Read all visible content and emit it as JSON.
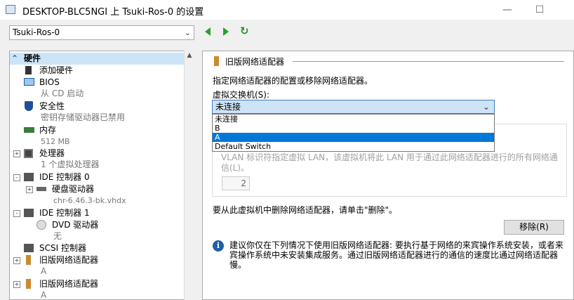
{
  "window": {
    "title": "DESKTOP-BLC5NGI 上 Tsuki-Ros-0 的设置"
  },
  "toolbar": {
    "vm_selected": "Tsuki-Ros-0"
  },
  "tree": {
    "section_hardware": "硬件",
    "add_hardware": "添加硬件",
    "bios": {
      "label": "BIOS",
      "sub": "从 CD 启动"
    },
    "security": {
      "label": "安全性",
      "sub": "密钥存储驱动器已禁用"
    },
    "memory": {
      "label": "内存",
      "sub": "512 MB"
    },
    "processor": {
      "label": "处理器",
      "sub": "1 个虚拟处理器"
    },
    "ide0": {
      "label": "IDE 控制器 0"
    },
    "harddisk": {
      "label": "硬盘驱动器",
      "sub": "chr-6.46.3-bk.vhdx"
    },
    "ide1": {
      "label": "IDE 控制器 1"
    },
    "dvd": {
      "label": "DVD 驱动器",
      "sub": "无"
    },
    "scsi": {
      "label": "SCSI 控制器"
    },
    "legacy_nic_1": {
      "label": "旧版网络适配器",
      "sub": "A"
    },
    "legacy_nic_2": {
      "label": "旧版网络适配器",
      "sub": "A"
    }
  },
  "main": {
    "section_title": "旧版网络适配器",
    "description": "指定网络适配器的配置或移除网络适配器。",
    "switch_label": "虚拟交换机(S):",
    "switch_value": "未连接",
    "switch_options": [
      "未连接",
      "B",
      "A",
      "Default Switch"
    ],
    "switch_highlighted": "A",
    "vlan_text": "VLAN 标识符指定虚拟 LAN，该虚拟机将此 LAN 用于通过此网络适配器进行的所有网络通信(L)。",
    "vlan_value": "2",
    "remove_text": "要从此虚拟机中删除网络适配器，请单击\"删除\"。",
    "remove_button": "移除(R)",
    "info_text_1": "建议你仅在下列情况下使用旧版网络适配器: 要执行基于网络的来宾操作系统安装，或者来",
    "info_text_2": "宾操作系统中未安装集成服务。通过旧版网络适配器进行的通信的速度比通过网络适配器",
    "info_text_3": "慢。"
  }
}
